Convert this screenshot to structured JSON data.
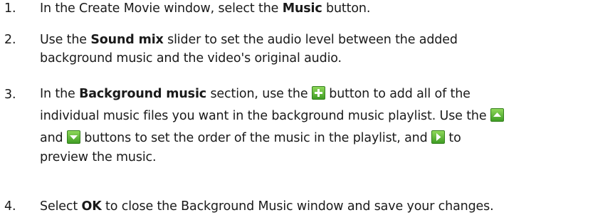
{
  "steps": [
    {
      "num": "1.",
      "l1a": "In the Create Movie window, select the ",
      "l1b": "Music",
      "l1c": " button."
    },
    {
      "num": "2.",
      "l1a": "Use the ",
      "l1b": "Sound mix",
      "l1c": " slider to set the audio level between the added",
      "l2": "background music and the video's original audio."
    },
    {
      "num": "3.",
      "l1a": "In the ",
      "l1b": "Background music",
      "l1c": " section, use the ",
      "l1d": " button to add all of the",
      "l2a": "individual music files you want in the background music playlist. Use the ",
      "l3a": "and ",
      "l3b": " buttons to set the order of the music in the playlist, and ",
      "l3c": " to",
      "l4": "preview the music.",
      "icons": [
        "plus-icon",
        "up-arrow-icon",
        "down-arrow-icon",
        "play-icon"
      ]
    },
    {
      "num": "4.",
      "l1a": "Select ",
      "l1b": "OK",
      "l1c": " to close the Background Music window and save your changes."
    }
  ]
}
